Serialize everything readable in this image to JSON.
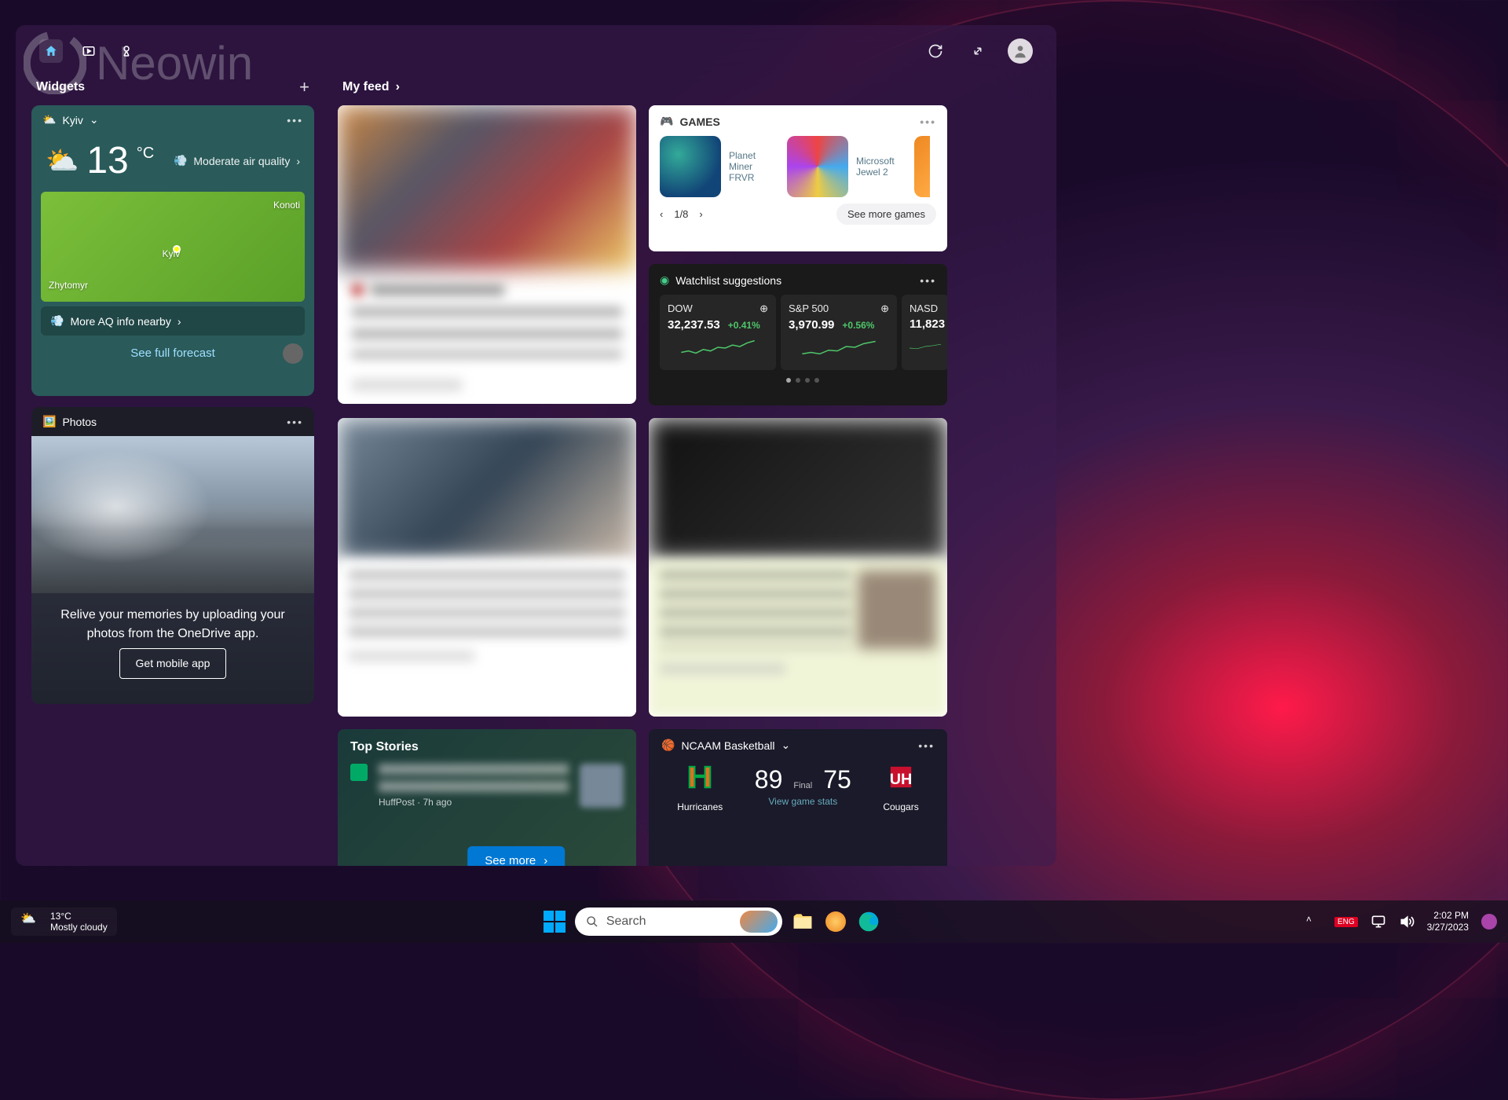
{
  "watermark": "Neowin",
  "panel": {
    "widgets_title": "Widgets",
    "feed_title": "My feed"
  },
  "weather": {
    "location": "Kyiv",
    "temp": "13",
    "unit": "°C",
    "aqi_label": "Moderate air quality",
    "map_labels": {
      "city": "Kyiv",
      "west": "Zhytomyr",
      "east": "Konoti"
    },
    "aq_more": "More AQ info nearby",
    "forecast_link": "See full forecast"
  },
  "photos": {
    "title": "Photos",
    "message": "Relive your memories by uploading your photos from the OneDrive app.",
    "button": "Get mobile app"
  },
  "games": {
    "title": "GAMES",
    "items": [
      {
        "name": "Planet Miner FRVR"
      },
      {
        "name": "Microsoft Jewel 2"
      }
    ],
    "page": "1/8",
    "see_more": "See more games"
  },
  "watchlist": {
    "title": "Watchlist suggestions",
    "stocks": [
      {
        "name": "DOW",
        "value": "32,237.53",
        "change": "+0.41%"
      },
      {
        "name": "S&P 500",
        "value": "3,970.99",
        "change": "+0.56%"
      },
      {
        "name": "NASD",
        "value": "11,823",
        "change": ""
      }
    ]
  },
  "topstories": {
    "title": "Top Stories",
    "source": "HuffPost · 7h ago",
    "see_more": "See more"
  },
  "sports": {
    "league": "NCAAM Basketball",
    "team_a": {
      "name": "Hurricanes",
      "score": "89",
      "color": "#e07020"
    },
    "final": "Final",
    "team_b": {
      "name": "Cougars",
      "score": "75",
      "color": "#c8102e"
    },
    "link": "View game stats"
  },
  "taskbar": {
    "weather_temp": "13°C",
    "weather_label": "Mostly cloudy",
    "search_placeholder": "Search",
    "time": "2:02 PM",
    "date": "3/27/2023",
    "lang": "ENG"
  }
}
